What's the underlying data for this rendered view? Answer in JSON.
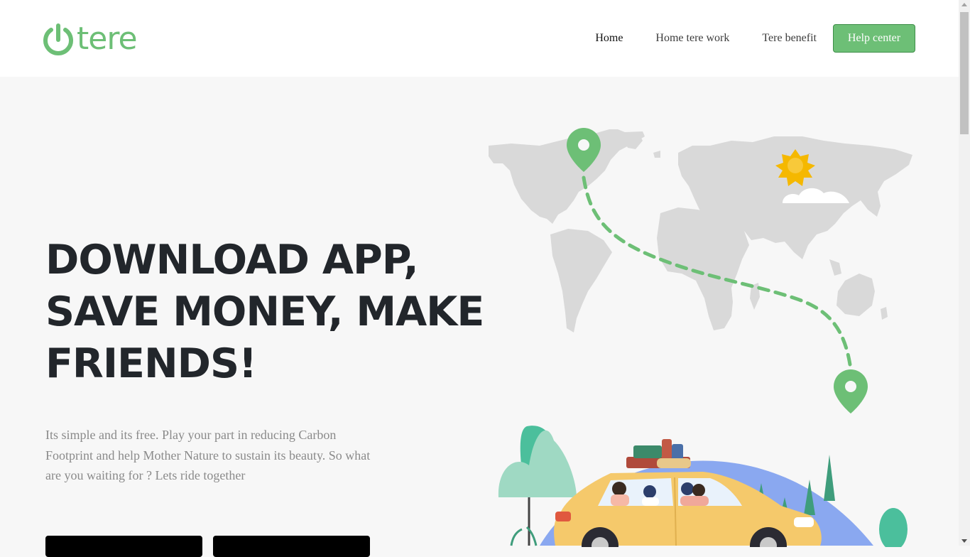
{
  "brand": {
    "name": "tere",
    "color": "#6dbf76"
  },
  "nav": {
    "items": [
      {
        "label": "Home",
        "active": true
      },
      {
        "label": "Home tere work",
        "active": false
      },
      {
        "label": "Tere benefit",
        "active": false
      }
    ],
    "help_label": "Help center"
  },
  "hero": {
    "title_lines": [
      "DOWNLOAD APP,",
      "SAVE MONEY, MAKE",
      "FRIENDS!"
    ],
    "description": "Its simple and its free. Play your part in reducing Carbon Footprint and help Mother Nature to sustain its beauty. So what are you waiting for ? Lets ride together"
  },
  "icons": {
    "logo": "power-icon",
    "map_pins": "location-pin-icon",
    "sun": "sun-icon",
    "cloud": "cloud-icon"
  },
  "colors": {
    "accent": "#6dbf76",
    "title": "#22262b",
    "body_text": "#8a8a8a",
    "background": "#f7f7f7",
    "car": "#f5c96b"
  }
}
